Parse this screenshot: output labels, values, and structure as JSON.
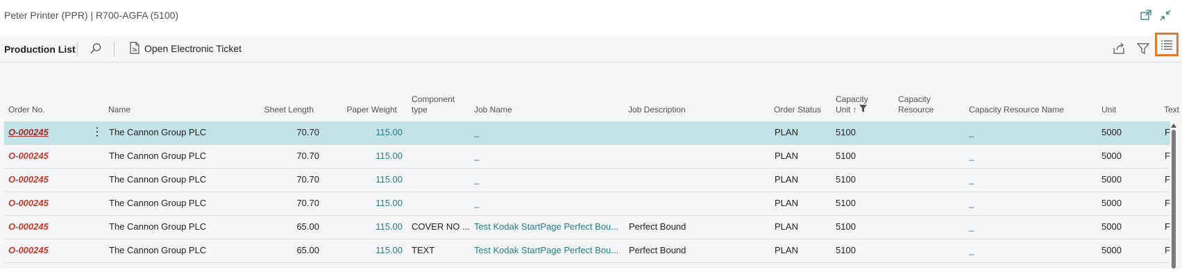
{
  "window": {
    "title": "Peter Printer (PPR) | R700-AGFA (5100)",
    "icons": [
      "open-new-window-icon",
      "collapse-icon"
    ]
  },
  "toolbar": {
    "title": "Production List",
    "search_icon": "search-icon",
    "open_ticket_label": "Open Electronic Ticket",
    "right_icons": [
      "share-icon",
      "filter-icon",
      "list-view-icon"
    ]
  },
  "columns": {
    "order_no": "Order No.",
    "name": "Name",
    "sheet_length": "Sheet Length",
    "paper_weight": "Paper Weight",
    "component_type_1": "Component",
    "component_type_2": "type",
    "job_name": "Job Name",
    "job_description": "Job Description",
    "order_status": "Order Status",
    "capacity_unit_1": "Capacity",
    "capacity_unit_2": "Unit",
    "capacity_resource_1": "Capacity",
    "capacity_resource_2": "Resource",
    "capacity_resource_name": "Capacity Resource Name",
    "unit": "Unit",
    "text": "Text"
  },
  "rows": [
    {
      "order_no": "O-000245",
      "name": "The Cannon Group PLC",
      "sheet_length": "70.70",
      "paper_weight": "115.00",
      "component_type": "",
      "job_name": "_",
      "job_description": "",
      "order_status": "PLAN",
      "capacity_unit": "5100",
      "capacity_resource": "",
      "capacity_resource_name": "_",
      "unit": "5000",
      "text": "F"
    },
    {
      "order_no": "O-000245",
      "name": "The Cannon Group PLC",
      "sheet_length": "70.70",
      "paper_weight": "115.00",
      "component_type": "",
      "job_name": "_",
      "job_description": "",
      "order_status": "PLAN",
      "capacity_unit": "5100",
      "capacity_resource": "",
      "capacity_resource_name": "_",
      "unit": "5000",
      "text": "F"
    },
    {
      "order_no": "O-000245",
      "name": "The Cannon Group PLC",
      "sheet_length": "70.70",
      "paper_weight": "115.00",
      "component_type": "",
      "job_name": "_",
      "job_description": "",
      "order_status": "PLAN",
      "capacity_unit": "5100",
      "capacity_resource": "",
      "capacity_resource_name": "_",
      "unit": "5000",
      "text": "F"
    },
    {
      "order_no": "O-000245",
      "name": "The Cannon Group PLC",
      "sheet_length": "70.70",
      "paper_weight": "115.00",
      "component_type": "",
      "job_name": "_",
      "job_description": "",
      "order_status": "PLAN",
      "capacity_unit": "5100",
      "capacity_resource": "",
      "capacity_resource_name": "_",
      "unit": "5000",
      "text": "F"
    },
    {
      "order_no": "O-000245",
      "name": "The Cannon Group PLC",
      "sheet_length": "65.00",
      "paper_weight": "115.00",
      "component_type": "COVER NO ...",
      "job_name": "Test Kodak StartPage Perfect Bou...",
      "job_description": "Perfect Bound",
      "order_status": "PLAN",
      "capacity_unit": "5100",
      "capacity_resource": "",
      "capacity_resource_name": "_",
      "unit": "5000",
      "text": "F"
    },
    {
      "order_no": "O-000245",
      "name": "The Cannon Group PLC",
      "sheet_length": "65.00",
      "paper_weight": "115.00",
      "component_type": "TEXT",
      "job_name": "Test Kodak StartPage Perfect Bou...",
      "job_description": "Perfect Bound",
      "order_status": "PLAN",
      "capacity_unit": "5100",
      "capacity_resource": "",
      "capacity_resource_name": "_",
      "unit": "5000",
      "text": "F"
    }
  ],
  "colors": {
    "accent": "#e07b2a",
    "selected_row": "#c1e3e8",
    "order_link": "#c0392b",
    "teal_value": "#2b7b7e"
  }
}
